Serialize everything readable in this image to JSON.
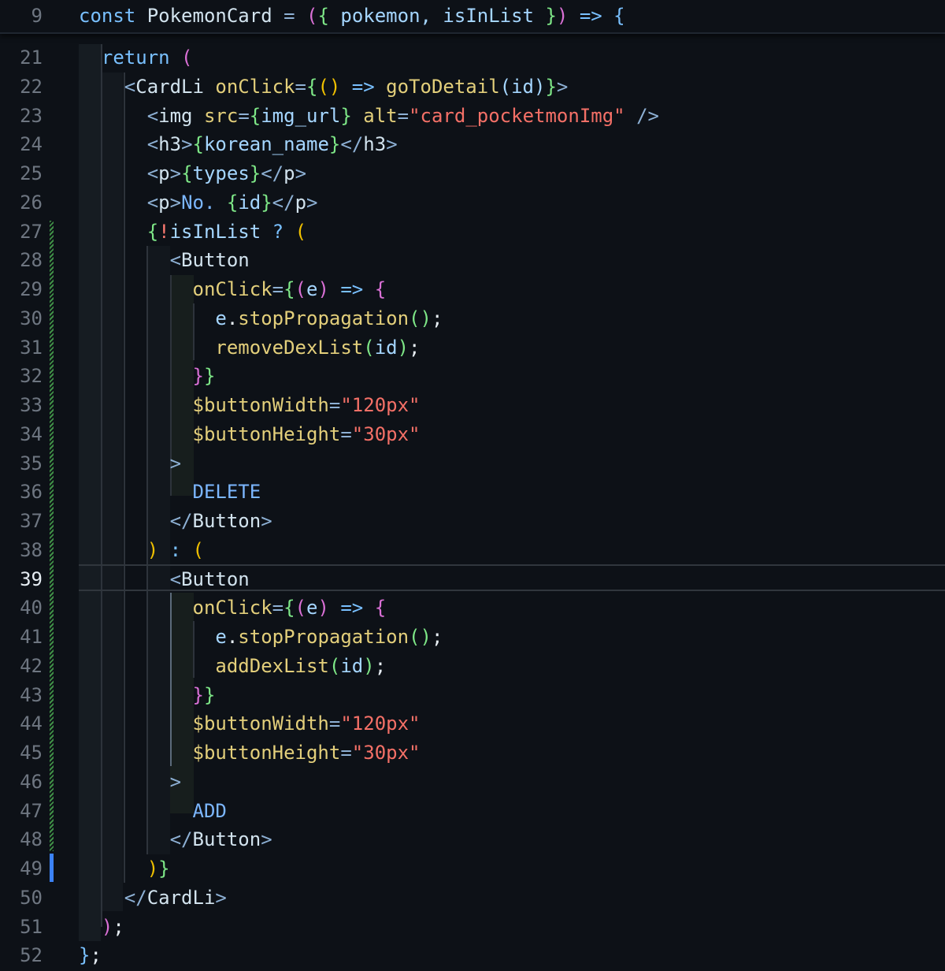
{
  "editor": {
    "sticky_header": {
      "line_number": "9",
      "segments": [
        {
          "t": "const ",
          "c": "kw"
        },
        {
          "t": "PokemonCard",
          "c": "comp"
        },
        {
          "t": " = ",
          "c": "pun"
        },
        {
          "t": "(",
          "c": "br2"
        },
        {
          "t": "{",
          "c": "br3"
        },
        {
          "t": " pokemon, isInList ",
          "c": "var"
        },
        {
          "t": "}",
          "c": "br3"
        },
        {
          "t": ")",
          "c": "br2"
        },
        {
          "t": " => ",
          "c": "kw"
        },
        {
          "t": "{",
          "c": "kw"
        }
      ]
    },
    "active_line": "39",
    "lines": [
      {
        "n": "21",
        "segments": [
          {
            "t": "  return ",
            "c": "kw"
          },
          {
            "t": "(",
            "c": "br2"
          }
        ]
      },
      {
        "n": "22",
        "segments": [
          {
            "t": "    <",
            "c": "pun"
          },
          {
            "t": "CardLi",
            "c": "comp"
          },
          {
            "t": " onClick",
            "c": "attr"
          },
          {
            "t": "=",
            "c": "pun"
          },
          {
            "t": "{",
            "c": "br3"
          },
          {
            "t": "()",
            "c": "br1"
          },
          {
            "t": " => ",
            "c": "kw"
          },
          {
            "t": "goToDetail",
            "c": "fn"
          },
          {
            "t": "(id)",
            "c": "var"
          },
          {
            "t": "}",
            "c": "br3"
          },
          {
            "t": ">",
            "c": "pun"
          }
        ]
      },
      {
        "n": "23",
        "segments": [
          {
            "t": "      <",
            "c": "pun"
          },
          {
            "t": "img",
            "c": "comp"
          },
          {
            "t": " src",
            "c": "attr"
          },
          {
            "t": "=",
            "c": "pun"
          },
          {
            "t": "{",
            "c": "br3"
          },
          {
            "t": "img_url",
            "c": "var"
          },
          {
            "t": "}",
            "c": "br3"
          },
          {
            "t": " alt",
            "c": "attr"
          },
          {
            "t": "=",
            "c": "pun"
          },
          {
            "t": "\"card_pocketmonImg\"",
            "c": "str"
          },
          {
            "t": " />",
            "c": "pun"
          }
        ]
      },
      {
        "n": "24",
        "segments": [
          {
            "t": "      <",
            "c": "pun"
          },
          {
            "t": "h3",
            "c": "comp"
          },
          {
            "t": ">",
            "c": "pun"
          },
          {
            "t": "{",
            "c": "br3"
          },
          {
            "t": "korean_name",
            "c": "var"
          },
          {
            "t": "}",
            "c": "br3"
          },
          {
            "t": "</",
            "c": "pun"
          },
          {
            "t": "h3",
            "c": "comp"
          },
          {
            "t": ">",
            "c": "pun"
          }
        ]
      },
      {
        "n": "25",
        "segments": [
          {
            "t": "      <",
            "c": "pun"
          },
          {
            "t": "p",
            "c": "comp"
          },
          {
            "t": ">",
            "c": "pun"
          },
          {
            "t": "{",
            "c": "br3"
          },
          {
            "t": "types",
            "c": "var"
          },
          {
            "t": "}",
            "c": "br3"
          },
          {
            "t": "</",
            "c": "pun"
          },
          {
            "t": "p",
            "c": "comp"
          },
          {
            "t": ">",
            "c": "pun"
          }
        ]
      },
      {
        "n": "26",
        "segments": [
          {
            "t": "      <",
            "c": "pun"
          },
          {
            "t": "p",
            "c": "comp"
          },
          {
            "t": ">",
            "c": "pun"
          },
          {
            "t": "No. ",
            "c": "txt"
          },
          {
            "t": "{",
            "c": "br3"
          },
          {
            "t": "id",
            "c": "var"
          },
          {
            "t": "}",
            "c": "br3"
          },
          {
            "t": "</",
            "c": "pun"
          },
          {
            "t": "p",
            "c": "comp"
          },
          {
            "t": ">",
            "c": "pun"
          }
        ]
      },
      {
        "n": "27",
        "segments": [
          {
            "t": "      {",
            "c": "br3"
          },
          {
            "t": "!",
            "c": "kw2"
          },
          {
            "t": "isInList",
            "c": "var"
          },
          {
            "t": " ? ",
            "c": "kw"
          },
          {
            "t": "(",
            "c": "br1"
          }
        ]
      },
      {
        "n": "28",
        "segments": [
          {
            "t": "        <",
            "c": "pun"
          },
          {
            "t": "Button",
            "c": "comp"
          }
        ]
      },
      {
        "n": "29",
        "segments": [
          {
            "t": "          onClick",
            "c": "attr"
          },
          {
            "t": "=",
            "c": "pun"
          },
          {
            "t": "{",
            "c": "br3"
          },
          {
            "t": "(",
            "c": "br2"
          },
          {
            "t": "e",
            "c": "var"
          },
          {
            "t": ")",
            "c": "br2"
          },
          {
            "t": " => ",
            "c": "kw"
          },
          {
            "t": "{",
            "c": "br2"
          }
        ]
      },
      {
        "n": "30",
        "segments": [
          {
            "t": "            e",
            "c": "var"
          },
          {
            "t": ".",
            "c": "plain"
          },
          {
            "t": "stopPropagation",
            "c": "fn"
          },
          {
            "t": "()",
            "c": "br3"
          },
          {
            "t": ";",
            "c": "plain"
          }
        ]
      },
      {
        "n": "31",
        "segments": [
          {
            "t": "            removeDexList",
            "c": "fn"
          },
          {
            "t": "(",
            "c": "br3"
          },
          {
            "t": "id",
            "c": "var"
          },
          {
            "t": ")",
            "c": "br3"
          },
          {
            "t": ";",
            "c": "plain"
          }
        ]
      },
      {
        "n": "32",
        "segments": [
          {
            "t": "          }",
            "c": "br2"
          },
          {
            "t": "}",
            "c": "br3"
          }
        ]
      },
      {
        "n": "33",
        "segments": [
          {
            "t": "          $buttonWidth",
            "c": "attr"
          },
          {
            "t": "=",
            "c": "pun"
          },
          {
            "t": "\"120px\"",
            "c": "str"
          }
        ]
      },
      {
        "n": "34",
        "segments": [
          {
            "t": "          $buttonHeight",
            "c": "attr"
          },
          {
            "t": "=",
            "c": "pun"
          },
          {
            "t": "\"30px\"",
            "c": "str"
          }
        ]
      },
      {
        "n": "35",
        "segments": [
          {
            "t": "        >",
            "c": "pun"
          }
        ]
      },
      {
        "n": "36",
        "segments": [
          {
            "t": "          DELETE",
            "c": "txt"
          }
        ]
      },
      {
        "n": "37",
        "segments": [
          {
            "t": "        </",
            "c": "pun"
          },
          {
            "t": "Button",
            "c": "comp"
          },
          {
            "t": ">",
            "c": "pun"
          }
        ]
      },
      {
        "n": "38",
        "segments": [
          {
            "t": "      ) ",
            "c": "br1"
          },
          {
            "t": ": ",
            "c": "kw"
          },
          {
            "t": "(",
            "c": "br1"
          }
        ]
      },
      {
        "n": "39",
        "segments": [
          {
            "t": "        <",
            "c": "pun"
          },
          {
            "t": "Button",
            "c": "comp"
          }
        ]
      },
      {
        "n": "40",
        "segments": [
          {
            "t": "          onClick",
            "c": "attr"
          },
          {
            "t": "=",
            "c": "pun"
          },
          {
            "t": "{",
            "c": "br3"
          },
          {
            "t": "(",
            "c": "br2"
          },
          {
            "t": "e",
            "c": "var"
          },
          {
            "t": ")",
            "c": "br2"
          },
          {
            "t": " => ",
            "c": "kw"
          },
          {
            "t": "{",
            "c": "br2"
          }
        ]
      },
      {
        "n": "41",
        "segments": [
          {
            "t": "            e",
            "c": "var"
          },
          {
            "t": ".",
            "c": "plain"
          },
          {
            "t": "stopPropagation",
            "c": "fn"
          },
          {
            "t": "()",
            "c": "br3"
          },
          {
            "t": ";",
            "c": "plain"
          }
        ]
      },
      {
        "n": "42",
        "segments": [
          {
            "t": "            addDexList",
            "c": "fn"
          },
          {
            "t": "(",
            "c": "br3"
          },
          {
            "t": "id",
            "c": "var"
          },
          {
            "t": ")",
            "c": "br3"
          },
          {
            "t": ";",
            "c": "plain"
          }
        ]
      },
      {
        "n": "43",
        "segments": [
          {
            "t": "          }",
            "c": "br2"
          },
          {
            "t": "}",
            "c": "br3"
          }
        ]
      },
      {
        "n": "44",
        "segments": [
          {
            "t": "          $buttonWidth",
            "c": "attr"
          },
          {
            "t": "=",
            "c": "pun"
          },
          {
            "t": "\"120px\"",
            "c": "str"
          }
        ]
      },
      {
        "n": "45",
        "segments": [
          {
            "t": "          $buttonHeight",
            "c": "attr"
          },
          {
            "t": "=",
            "c": "pun"
          },
          {
            "t": "\"30px\"",
            "c": "str"
          }
        ]
      },
      {
        "n": "46",
        "segments": [
          {
            "t": "        >",
            "c": "pun"
          }
        ]
      },
      {
        "n": "47",
        "segments": [
          {
            "t": "          ADD",
            "c": "txt"
          }
        ]
      },
      {
        "n": "48",
        "segments": [
          {
            "t": "        </",
            "c": "pun"
          },
          {
            "t": "Button",
            "c": "comp"
          },
          {
            "t": ">",
            "c": "pun"
          }
        ]
      },
      {
        "n": "49",
        "segments": [
          {
            "t": "      )",
            "c": "br1"
          },
          {
            "t": "}",
            "c": "br3"
          }
        ]
      },
      {
        "n": "50",
        "segments": [
          {
            "t": "    </",
            "c": "pun"
          },
          {
            "t": "CardLi",
            "c": "comp"
          },
          {
            "t": ">",
            "c": "pun"
          }
        ]
      },
      {
        "n": "51",
        "segments": [
          {
            "t": "  )",
            "c": "br2"
          },
          {
            "t": ";",
            "c": "plain"
          }
        ]
      },
      {
        "n": "52",
        "segments": [
          {
            "t": "}",
            "c": "kw"
          },
          {
            "t": ";",
            "c": "plain"
          }
        ]
      }
    ]
  }
}
